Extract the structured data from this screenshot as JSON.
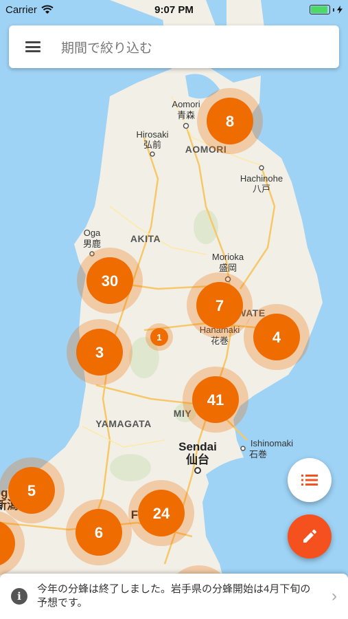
{
  "status_bar": {
    "carrier": "Carrier",
    "time": "9:07 PM"
  },
  "search": {
    "placeholder": "期間で絞り込む"
  },
  "map_labels": {
    "aomori_en": "Aomori",
    "aomori_jp": "青森",
    "aomori_region": "AOMORI",
    "hirosaki_en": "Hirosaki",
    "hirosaki_jp": "弘前",
    "hachinohe_en": "Hachinohe",
    "hachinohe_jp": "八戸",
    "oga_en": "Oga",
    "oga_jp": "男鹿",
    "akita_region": "AKITA",
    "morioka_en": "Morioka",
    "morioka_jp": "盛岡",
    "iwate_partial": "WATE",
    "hanamaki_en": "Hanamaki",
    "hanamaki_jp": "花巻",
    "miyagi_partial": "MIY",
    "yamagata_region": "YAMAGATA",
    "sendai_en": "Sendai",
    "sendai_jp": "仙台",
    "ishinomaki_en": "Ishinomaki",
    "ishinomaki_jp": "石巻",
    "left_partial_1": "ig",
    "left_partial_2": "新潟",
    "fukushima_partial": "F"
  },
  "clusters": [
    {
      "count": "8"
    },
    {
      "count": "30"
    },
    {
      "count": "7"
    },
    {
      "count": "4"
    },
    {
      "count": "1"
    },
    {
      "count": "3"
    },
    {
      "count": "41"
    },
    {
      "count": "5"
    },
    {
      "count": "24"
    },
    {
      "count": "6"
    }
  ],
  "notice": {
    "text": "今年の分蜂は終了しました。岩手県の分蜂開始は4月下旬の予想です。"
  },
  "colors": {
    "cluster": "#ef6c00",
    "fab_edit": "#f4511e",
    "water": "#9ed3f5"
  }
}
